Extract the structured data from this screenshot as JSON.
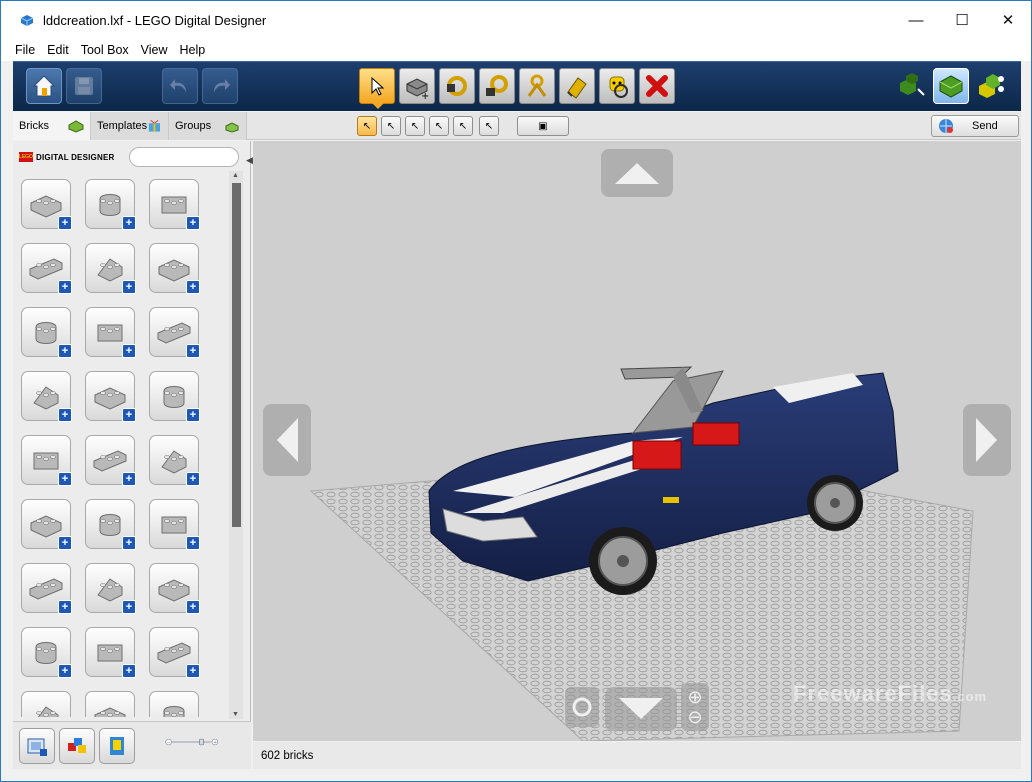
{
  "window": {
    "title": "lddcreation.lxf - LEGO Digital Designer",
    "min_glyph": "—",
    "max_glyph": "☐",
    "close_glyph": "✕"
  },
  "menu": [
    "File",
    "Edit",
    "Tool Box",
    "View",
    "Help"
  ],
  "toolbar": {
    "left_buttons": [
      "home-icon",
      "save-icon",
      "undo-icon",
      "redo-icon"
    ],
    "tools": [
      "select-icon",
      "clone-icon",
      "hinge-icon",
      "hinge-align-icon",
      "flex-icon",
      "paint-icon",
      "hide-icon",
      "delete-icon"
    ],
    "mode_buttons": [
      "build-mode-icon",
      "view-mode-icon",
      "building-guide-icon"
    ]
  },
  "tabs": [
    {
      "label": "Bricks",
      "icon": "brick-icon",
      "active": true
    },
    {
      "label": "Templates",
      "icon": "gift-icon",
      "active": false
    },
    {
      "label": "Groups",
      "icon": "group-icon",
      "active": false
    }
  ],
  "subtools": [
    "single-select-icon",
    "connected-select-icon",
    "color-select-icon",
    "shape-select-icon",
    "same-brick-select-icon"
  ],
  "send": {
    "label": "Send",
    "icon": "globe-icon"
  },
  "brand": {
    "text": "DIGITAL DESIGNER",
    "logo": "LEGO"
  },
  "search": {
    "placeholder": "",
    "value": ""
  },
  "brick_categories": [
    "brick-2x4",
    "round-brick",
    "technic-brick-hole",
    "brick-1x6",
    "roof-tile",
    "wedge",
    "arch-brick",
    "plate-2x2",
    "corner-plate",
    "technic-brick-1x2",
    "wheel-arch",
    "door-frame",
    "gear",
    "technic-connector",
    "technic-beam",
    "technic-liftarm",
    "axle-pin",
    "technic-gear",
    "curved-slope",
    "cylinder",
    "tile-flat",
    "wrench-tool",
    "panel-slope",
    "hinge-plate",
    "minifig-accessory",
    "steering-wheel",
    "grille"
  ],
  "bottom_tools": [
    "camera-icon",
    "color-palette-icon",
    "brick-box-icon"
  ],
  "zoom": {
    "level": 0.76
  },
  "viewport": {
    "nav_icons": [
      "arrow-up-icon",
      "arrow-left-icon",
      "arrow-right-icon",
      "arrow-down-icon",
      "zoom-in-icon",
      "zoom-out-icon"
    ],
    "model_colors": {
      "body": "#1b2a58",
      "stripe": "#f2f2f2",
      "seat": "#d41414",
      "baseplate": "#d6d6d6",
      "background": "#cfcfcf"
    }
  },
  "watermark": {
    "main": "FreewareFiles",
    "suffix": ".com"
  },
  "status": {
    "text": "602 bricks"
  }
}
